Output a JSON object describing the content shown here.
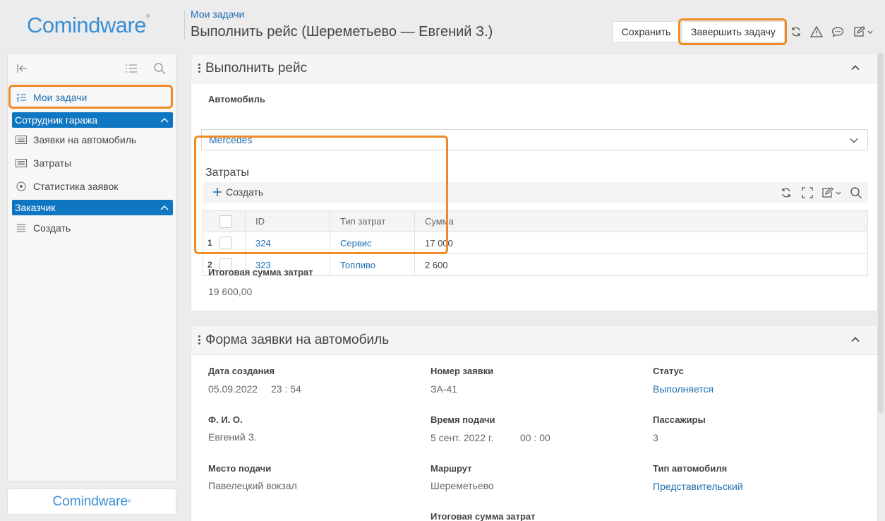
{
  "header": {
    "logo": "Comindware",
    "breadcrumb": "Мои задачи",
    "title": "Выполнить рейс (Шереметьево — Евгений З.)",
    "save_label": "Сохранить",
    "complete_label": "Завершить задачу"
  },
  "sidebar": {
    "my_tasks": "Мои задачи",
    "group_garage": "Сотрудник гаража",
    "items_garage": [
      "Заявки на автомобиль",
      "Затраты",
      "Статистика заявок"
    ],
    "group_customer": "Заказчик",
    "items_customer": [
      "Создать"
    ],
    "bottom_logo": "Comindware"
  },
  "panel1": {
    "title": "Выполнить рейс",
    "car_label": "Автомобиль",
    "car_value": "Mercedes",
    "costs_title": "Затраты",
    "create_label": "Создать",
    "columns": [
      "ID",
      "Тип затрат",
      "Сумма"
    ],
    "rows": [
      {
        "n": "1",
        "id": "324",
        "type": "Сервис",
        "sum": "17 000"
      },
      {
        "n": "2",
        "id": "323",
        "type": "Топливо",
        "sum": "2 600"
      }
    ],
    "total_label": "Итоговая сумма затрат",
    "total_value": "19 600,00"
  },
  "panel2": {
    "title": "Форма заявки на автомобиль",
    "created_label": "Дата создания",
    "created_date": "05.09.2022",
    "created_time": "23 : 54",
    "number_label": "Номер заявки",
    "number_value": "ЗА-41",
    "status_label": "Статус",
    "status_value": "Выполняется",
    "fio_label": "Ф. И. О.",
    "fio_value": "Евгений З.",
    "time_label": "Время подачи",
    "time_date": "5 сент. 2022 г.",
    "time_time": "00 : 00",
    "passengers_label": "Пассажиры",
    "passengers_value": "3",
    "place_label": "Место подачи",
    "place_value": "Павелецкий вокзал",
    "route_label": "Маршрут",
    "route_value": "Шереметьево",
    "cartype_label": "Тип автомобиля",
    "cartype_value": "Представительский",
    "total_label": "Итоговая сумма затрат"
  },
  "colors": {
    "accent": "#0f76c2",
    "link": "#1f6fb2",
    "highlight": "#f08a24",
    "logo": "#3a8fd6"
  },
  "icons": [
    "collapse-left-icon",
    "list-icon",
    "search-icon",
    "refresh-icon",
    "warning-icon",
    "comment-icon",
    "edit-icon",
    "fullscreen-icon",
    "plus-icon",
    "chevron-up-icon",
    "chevron-down-icon"
  ]
}
